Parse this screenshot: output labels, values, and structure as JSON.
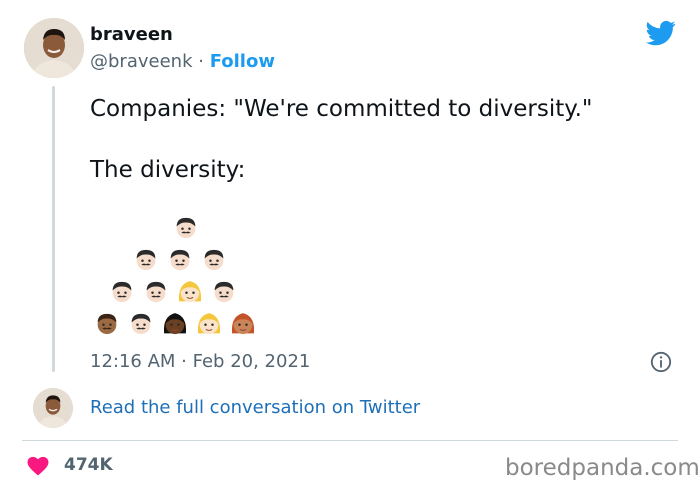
{
  "author": {
    "name": "braveen",
    "handle": "@braveenk",
    "separator": "·",
    "follow_label": "Follow"
  },
  "tweet": {
    "line1": "Companies: \"We're committed to diversity.\"",
    "line2": "The diversity:",
    "emoji_rows": [
      [
        "man"
      ],
      [
        "man",
        "man",
        "man"
      ],
      [
        "man",
        "man",
        "woman-blonde",
        "man"
      ],
      [
        "man-brown",
        "man",
        "woman-dark",
        "woman-blonde",
        "woman-red"
      ]
    ],
    "timestamp": "12:16 AM · Feb 20, 2021"
  },
  "read_more": "Read the full conversation on Twitter",
  "likes": "474K",
  "watermark": "boredpanda.com",
  "colors": {
    "twitter_blue": "#1d9bf0",
    "link_blue": "#1d6fb8",
    "heart": "#f91880",
    "muted": "#536471"
  },
  "icons": [
    "twitter-bird-icon",
    "info-icon",
    "heart-icon"
  ]
}
